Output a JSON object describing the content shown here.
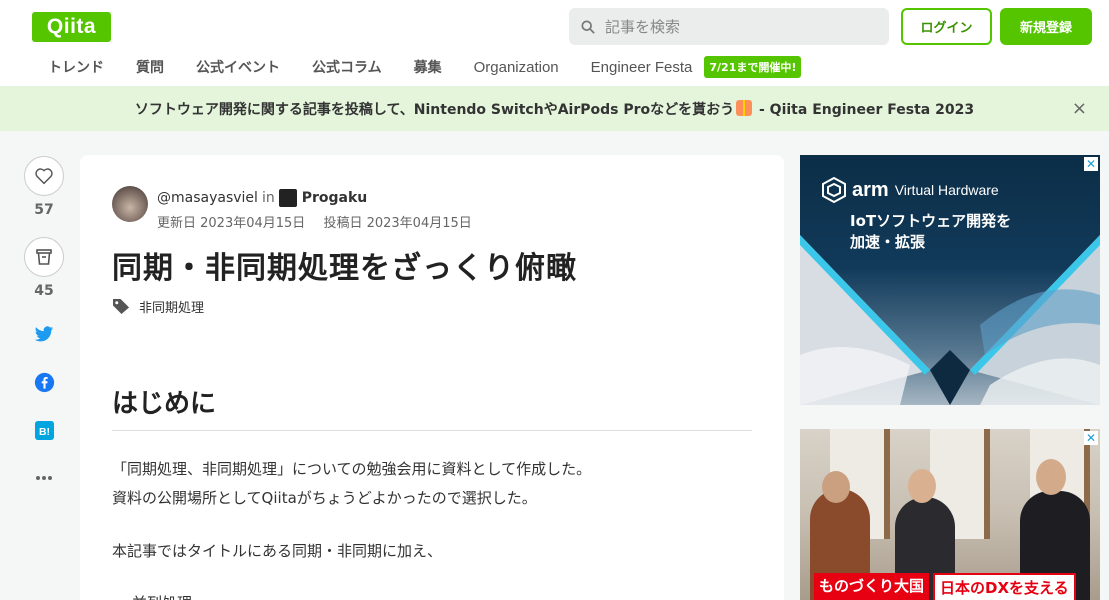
{
  "header": {
    "logo": "Qiita",
    "search_placeholder": "記事を検索",
    "login_label": "ログイン",
    "signup_label": "新規登録"
  },
  "nav": {
    "items": [
      "トレンド",
      "質問",
      "公式イベント",
      "公式コラム",
      "募集",
      "Organization",
      "Engineer Festa"
    ],
    "badge": "7/21まで開催中!"
  },
  "banner": {
    "text_before": "ソフトウェア開発に関する記事を投稿して、Nintendo SwitchやAirPods Proなどを貰おう",
    "text_after": " - Qiita Engineer Festa 2023",
    "close": "×"
  },
  "actions": {
    "likes": "57",
    "stocks": "45"
  },
  "article": {
    "author": "@masayasviel",
    "in": "in",
    "org": "Progaku",
    "updated": "更新日 2023年04月15日",
    "posted": "投稿日 2023年04月15日",
    "title": "同期・非同期処理をざっくり俯瞰",
    "tag": "非同期処理",
    "h2": "はじめに",
    "p1": "「同期処理、非同期処理」についての勉強会用に資料として作成した。",
    "p2": "資料の公開場所としてQiitaがちょうどよかったので選択した。",
    "p3": "本記事ではタイトルにある同期・非同期に加え、",
    "p4": "並列処理"
  },
  "ads": {
    "ad1_brand": "arm",
    "ad1_product": "Virtual Hardware",
    "ad1_line1": "IoTソフトウェア開発を",
    "ad1_line2": "加速・拡張",
    "ad2_caption1": "ものづくり大国",
    "ad2_caption2": "日本のDXを支える"
  },
  "colors": {
    "brand": "#55c500",
    "banner_bg": "#e4f5dc",
    "twitter": "#1d9bf0",
    "facebook": "#1877f2",
    "hatena": "#00a4de"
  }
}
